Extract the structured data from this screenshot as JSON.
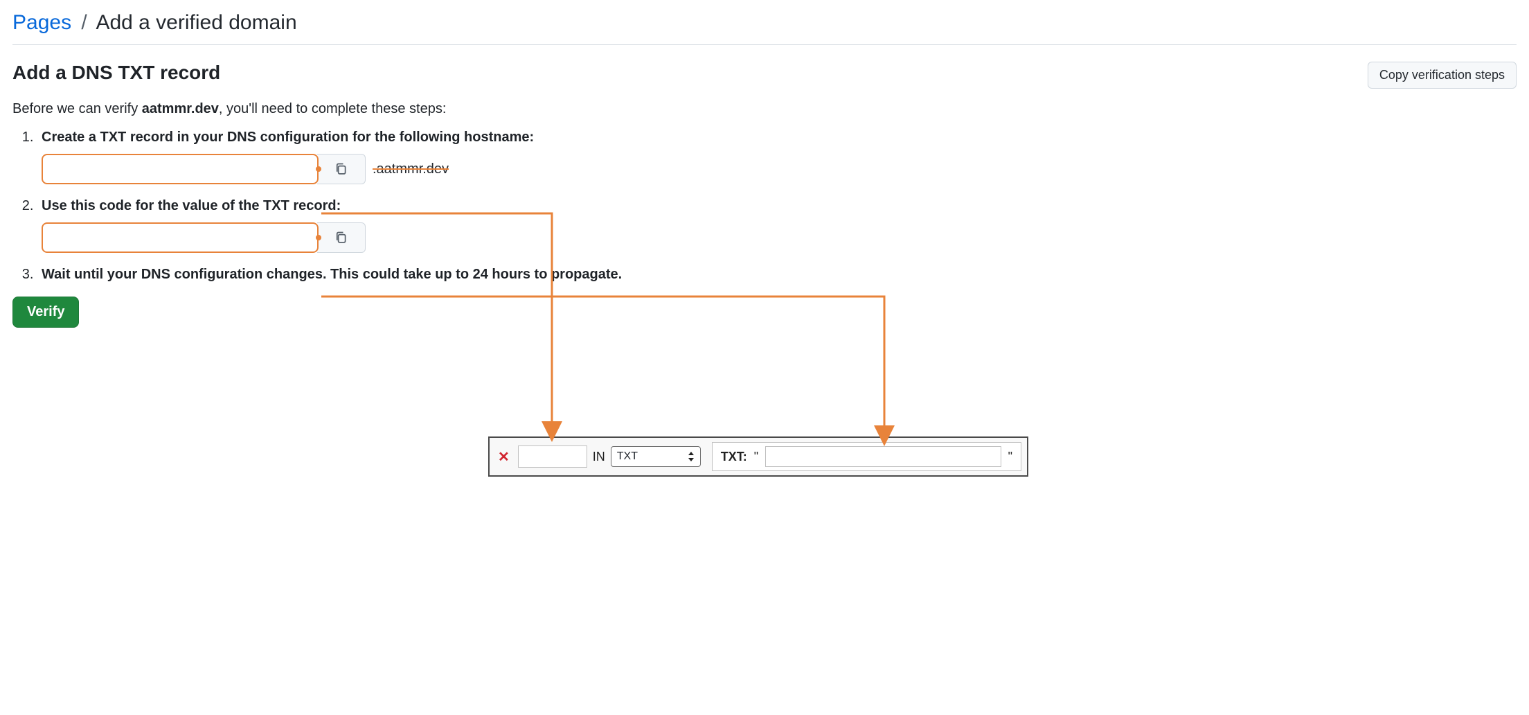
{
  "breadcrumb": {
    "parent": "Pages",
    "separator": "/",
    "current": "Add a verified domain"
  },
  "section": {
    "title": "Add a DNS TXT record",
    "copy_steps_label": "Copy verification steps",
    "intro_prefix": "Before we can verify ",
    "intro_domain": "aatmmr.dev",
    "intro_suffix": ", you'll need to complete these steps:"
  },
  "steps": {
    "one": "Create a TXT record in your DNS configuration for the following hostname:",
    "one_suffix": ".aatmmr.dev",
    "two": "Use this code for the value of the TXT record:",
    "three": "Wait until your DNS configuration changes. This could take up to 24 hours to propagate."
  },
  "buttons": {
    "verify": "Verify"
  },
  "dns": {
    "in": "IN",
    "type": "TXT",
    "label": "TXT:",
    "quote": "\""
  }
}
